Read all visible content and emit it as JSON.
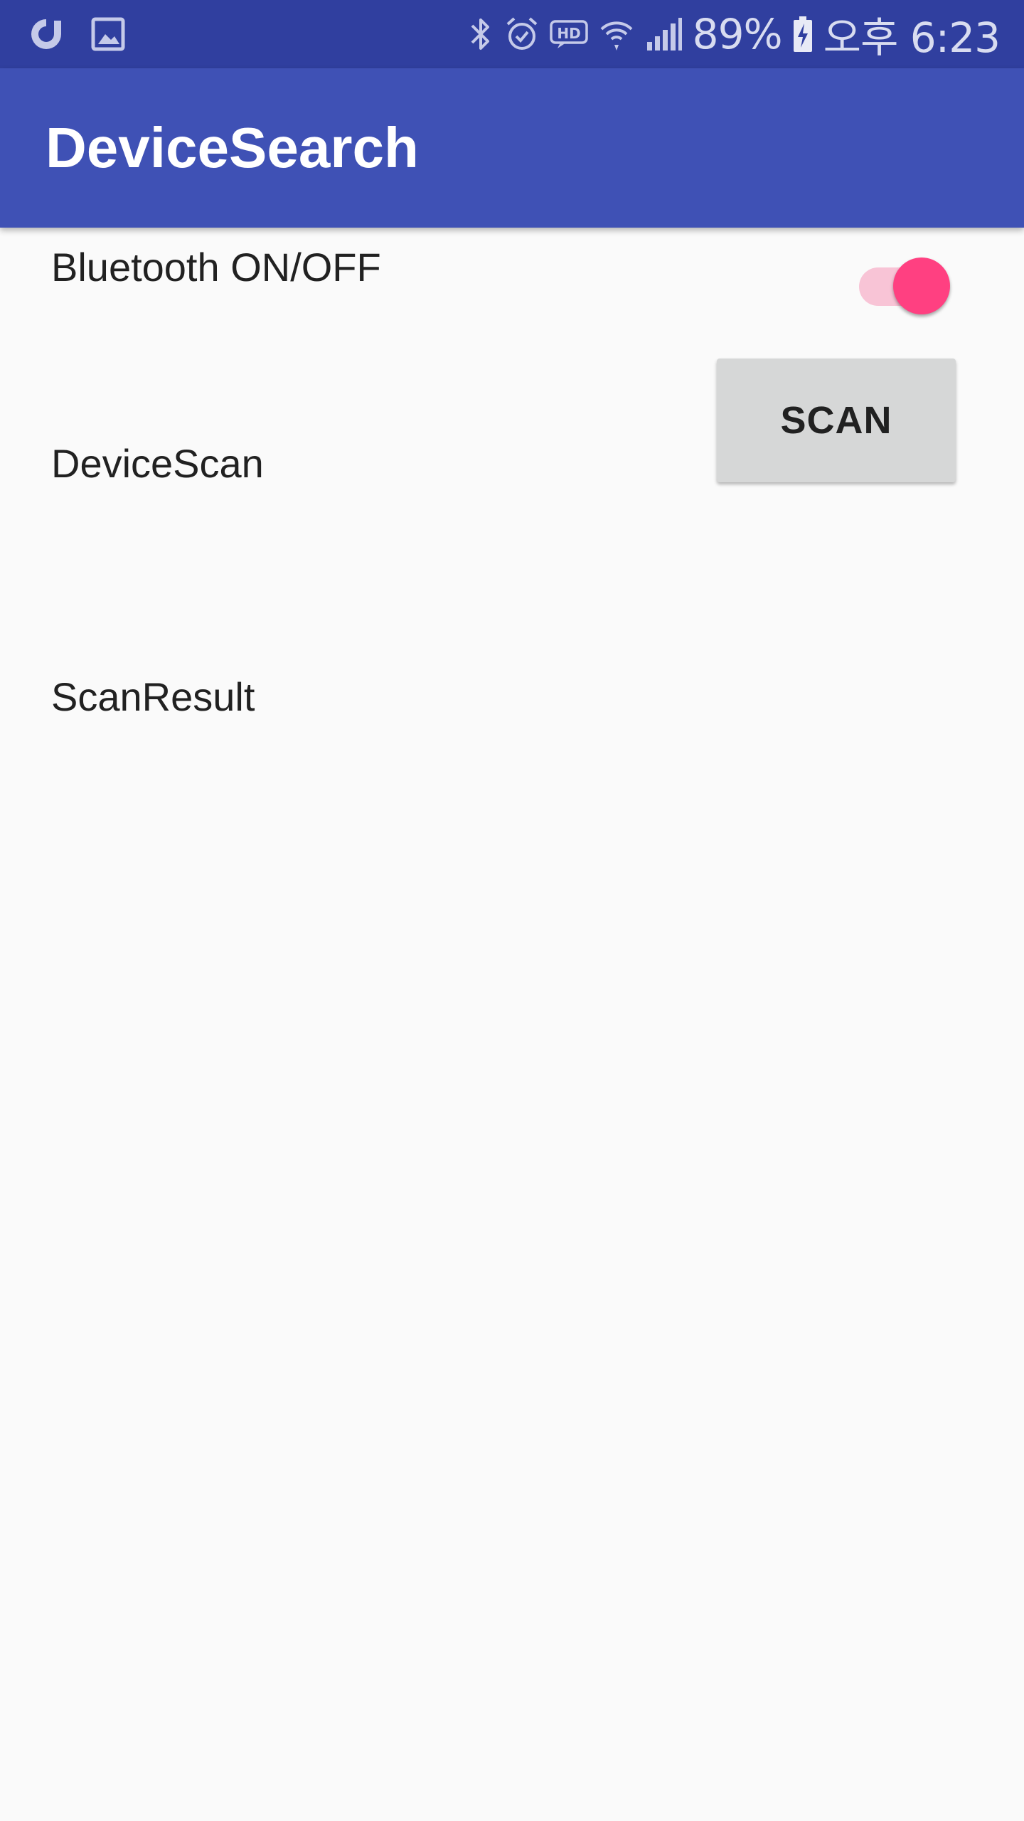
{
  "status_bar": {
    "left_icons": [
      "circle-app-icon",
      "image-icon"
    ],
    "right_icons": [
      "bluetooth-icon",
      "alarm-icon",
      "hd-icon",
      "wifi-icon",
      "signal-icon"
    ],
    "battery_percent": "89%",
    "battery_level": 0.89,
    "time": "오후 6:23"
  },
  "app_bar": {
    "title": "DeviceSearch"
  },
  "content": {
    "bluetooth_label": "Bluetooth ON/OFF",
    "bluetooth_switch_on": true,
    "device_scan_label": "DeviceScan",
    "scan_button_label": "SCAN",
    "scan_result_label": "ScanResult"
  },
  "colors": {
    "status_bar": "#303f9f",
    "app_bar": "#3f51b5",
    "accent": "#ff4081",
    "background": "#fafafa"
  }
}
